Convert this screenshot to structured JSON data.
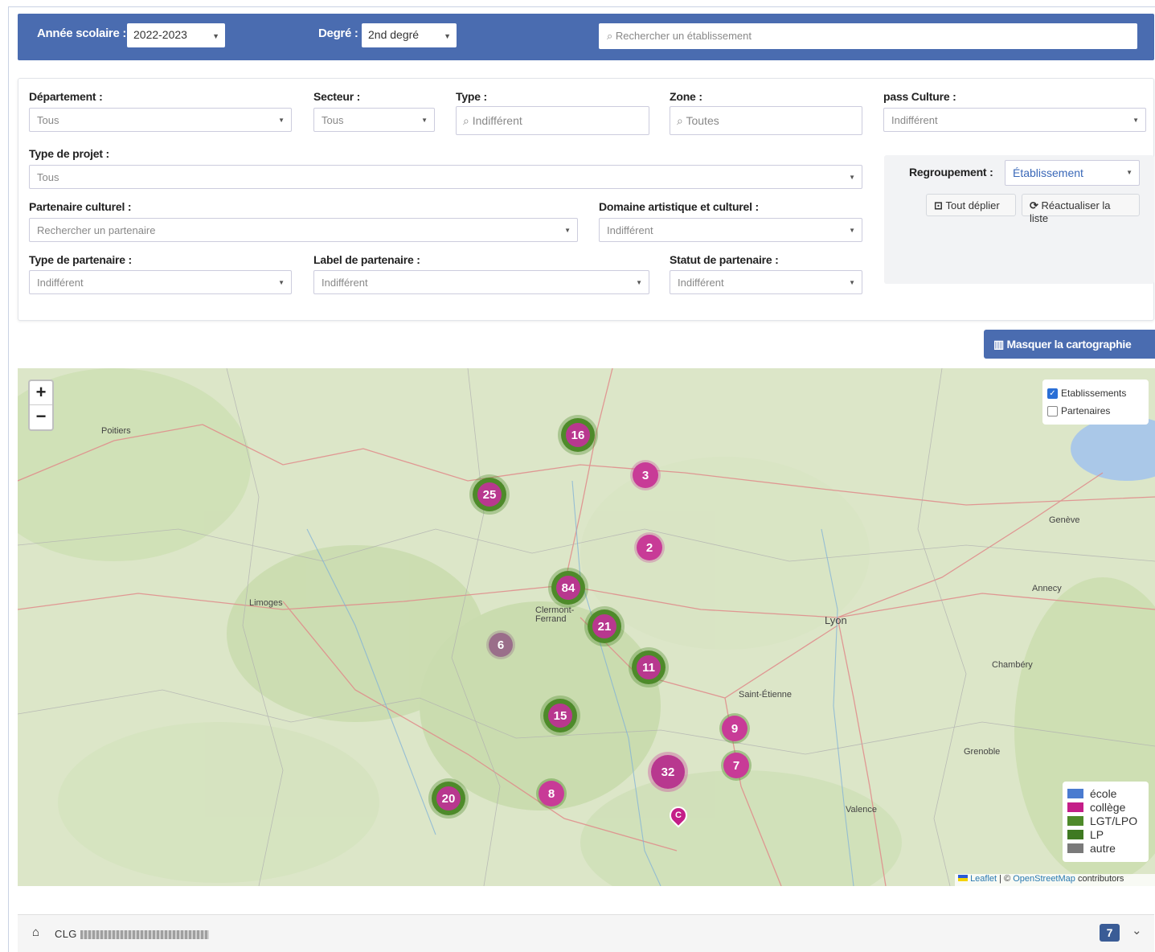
{
  "topbar": {
    "year_label": "Année scolaire :",
    "year_value": "2022-2023",
    "degree_label": "Degré :",
    "degree_value": "2nd degré",
    "search_placeholder": "Rechercher un établissement"
  },
  "filters": {
    "departement": {
      "label": "Département :",
      "value": "Tous"
    },
    "secteur": {
      "label": "Secteur :",
      "value": "Tous"
    },
    "type": {
      "label": "Type :",
      "value": "Indifférent"
    },
    "zone": {
      "label": "Zone :",
      "value": "Toutes"
    },
    "pass_culture": {
      "label": "pass Culture :",
      "value": "Indifférent"
    },
    "type_projet": {
      "label": "Type de projet :",
      "value": "Tous"
    },
    "partenaire_culturel": {
      "label": "Partenaire culturel :",
      "value": "Rechercher un partenaire"
    },
    "domaine": {
      "label": "Domaine artistique et culturel :",
      "value": "Indifférent"
    },
    "type_partenaire": {
      "label": "Type de partenaire :",
      "value": "Indifférent"
    },
    "label_partenaire": {
      "label": "Label de partenaire :",
      "value": "Indifférent"
    },
    "statut_partenaire": {
      "label": "Statut de partenaire :",
      "value": "Indifférent"
    }
  },
  "grouping": {
    "label": "Regroupement :",
    "value": "Établissement",
    "expand_all": "Tout déplier",
    "refresh": "Réactualiser la liste"
  },
  "map_toggle": "Masquer la cartographie",
  "map": {
    "zoom_in": "+",
    "zoom_out": "−",
    "layers": [
      {
        "label": "Etablissements",
        "checked": true
      },
      {
        "label": "Partenaires",
        "checked": false
      }
    ],
    "legend": [
      {
        "label": "école",
        "color": "#4a7bd0"
      },
      {
        "label": "collège",
        "color": "#c41e88"
      },
      {
        "label": "LGT/LPO",
        "color": "#4e8a2a"
      },
      {
        "label": "LP",
        "color": "#3f7a22"
      },
      {
        "label": "autre",
        "color": "#7a7a7a"
      }
    ],
    "attribution_leaflet": "Leaflet",
    "attribution_sep": " | © ",
    "attribution_osm": "OpenStreetMap",
    "attribution_rest": " contributors",
    "place_labels": [
      "Poitiers",
      "Limoges",
      "Clermont-Ferrand",
      "Lyon",
      "Saint-Étienne",
      "Annecy",
      "Genève",
      "Chambéry",
      "Grenoble",
      "Valence"
    ],
    "clusters": [
      {
        "count": "16"
      },
      {
        "count": "3"
      },
      {
        "count": "25"
      },
      {
        "count": "2"
      },
      {
        "count": "84"
      },
      {
        "count": "21"
      },
      {
        "count": "6"
      },
      {
        "count": "11"
      },
      {
        "count": "15"
      },
      {
        "count": "9"
      },
      {
        "count": "7"
      },
      {
        "count": "32"
      },
      {
        "count": "20"
      },
      {
        "count": "8"
      }
    ],
    "single_marker": "C"
  },
  "bottom": {
    "prefix": "CLG",
    "name": "",
    "count": "7"
  }
}
